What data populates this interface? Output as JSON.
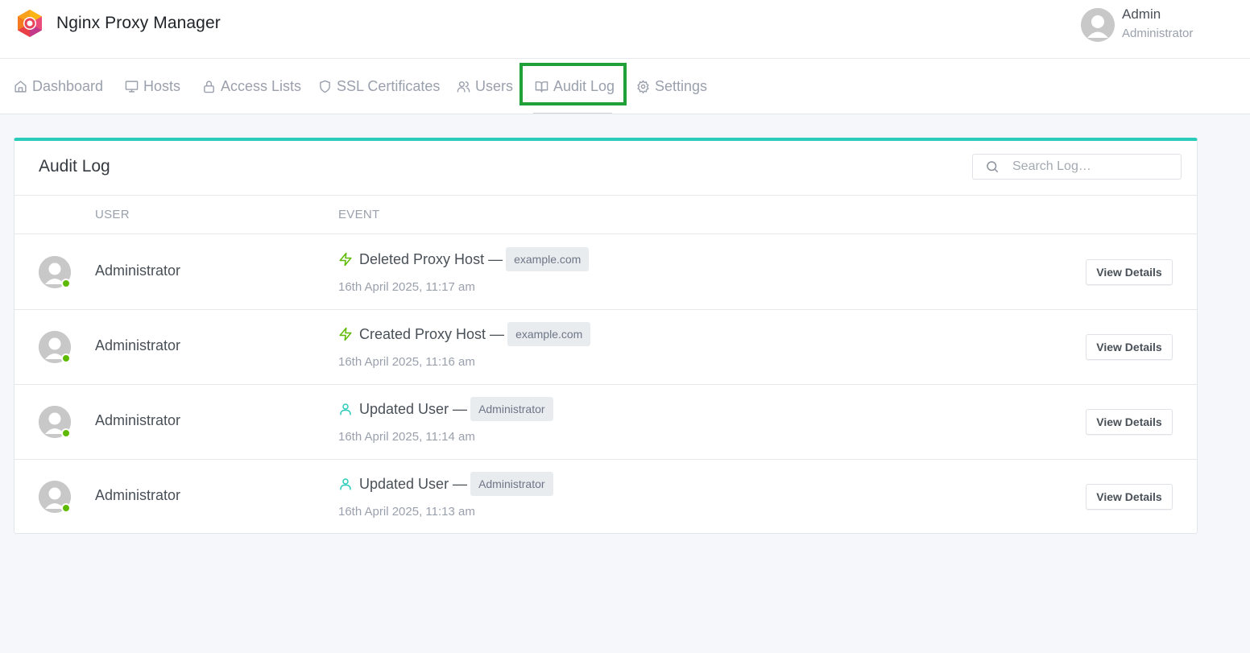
{
  "app": {
    "name": "Nginx Proxy Manager"
  },
  "user": {
    "name": "Admin",
    "role": "Administrator"
  },
  "nav": {
    "dashboard": "Dashboard",
    "hosts": "Hosts",
    "access_lists": "Access Lists",
    "ssl_certificates": "SSL Certificates",
    "users": "Users",
    "audit_log": "Audit Log",
    "settings": "Settings",
    "active": "Audit Log"
  },
  "audit": {
    "title": "Audit Log",
    "search_placeholder": "Search Log…",
    "columns": {
      "user": "USER",
      "event": "EVENT"
    },
    "view_details_label": "View Details",
    "rows": [
      {
        "user": "Administrator",
        "icon": "lightning-icon",
        "icon_color": "#5eba00",
        "event": "Deleted Proxy Host —",
        "tag": "example.com",
        "time": "16th April 2025, 11:17 am"
      },
      {
        "user": "Administrator",
        "icon": "lightning-icon",
        "icon_color": "#5eba00",
        "event": "Created Proxy Host —",
        "tag": "example.com",
        "time": "16th April 2025, 11:16 am"
      },
      {
        "user": "Administrator",
        "icon": "user-icon",
        "icon_color": "#2bcbba",
        "event": "Updated User —",
        "tag": "Administrator",
        "time": "16th April 2025, 11:14 am"
      },
      {
        "user": "Administrator",
        "icon": "user-icon",
        "icon_color": "#2bcbba",
        "event": "Updated User —",
        "tag": "Administrator",
        "time": "16th April 2025, 11:13 am"
      }
    ]
  },
  "colors": {
    "accent_teal": "#2bcbba",
    "online_green": "#5eba00",
    "highlight_box": "#21a038"
  }
}
